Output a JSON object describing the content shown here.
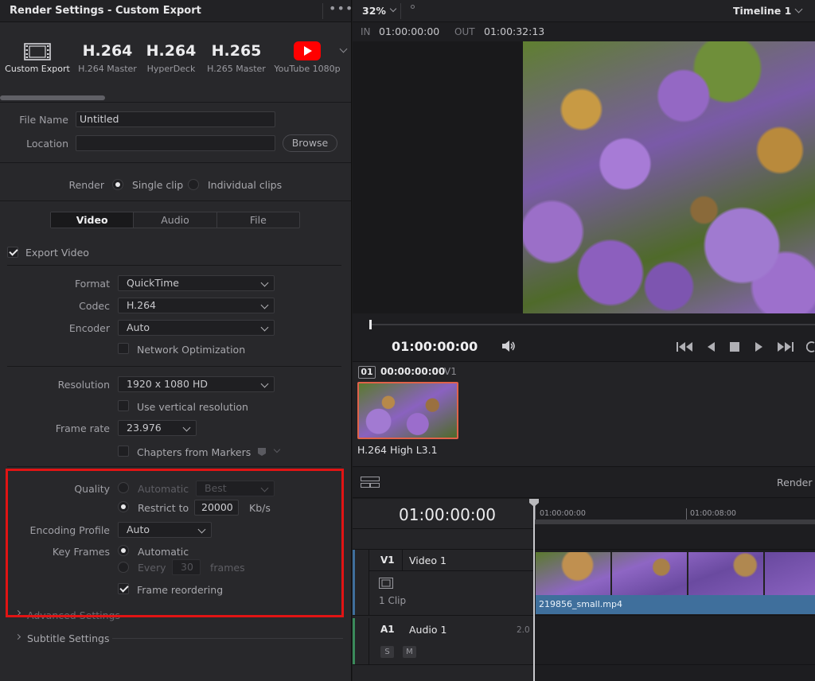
{
  "left_panel": {
    "title": "Render Settings - Custom Export",
    "menu": "•••",
    "presets": [
      {
        "title": "",
        "label": "Custom Export",
        "icon": "film-strip-icon"
      },
      {
        "title": "H.264",
        "label": "H.264 Master"
      },
      {
        "title": "H.264",
        "label": "HyperDeck"
      },
      {
        "title": "H.265",
        "label": "H.265 Master"
      },
      {
        "title": "",
        "label": "YouTube 1080p",
        "icon": "youtube-icon"
      }
    ],
    "file_name_label": "File Name",
    "file_name_value": "Untitled",
    "location_label": "Location",
    "location_value": "",
    "browse_label": "Browse",
    "render_label": "Render",
    "render_single": "Single clip",
    "render_individual": "Individual clips",
    "tabs": [
      "Video",
      "Audio",
      "File"
    ],
    "export_video_label": "Export Video",
    "format_label": "Format",
    "format_value": "QuickTime",
    "codec_label": "Codec",
    "codec_value": "H.264",
    "encoder_label": "Encoder",
    "encoder_value": "Auto",
    "network_opt_label": "Network Optimization",
    "resolution_label": "Resolution",
    "resolution_value": "1920 x 1080 HD",
    "vertical_res_label": "Use vertical resolution",
    "frame_rate_label": "Frame rate",
    "frame_rate_value": "23.976",
    "chapters_label": "Chapters from Markers",
    "quality_label": "Quality",
    "quality_auto": "Automatic",
    "quality_auto_value": "Best",
    "quality_restrict": "Restrict to",
    "quality_restrict_value": "20000",
    "quality_unit": "Kb/s",
    "encoding_profile_label": "Encoding Profile",
    "encoding_profile_value": "Auto",
    "key_frames_label": "Key Frames",
    "key_frames_auto": "Automatic",
    "key_frames_every": "Every",
    "key_frames_every_value": "30",
    "key_frames_unit": "frames",
    "frame_reordering_label": "Frame reordering",
    "advanced_settings": "Advanced Settings",
    "subtitle_settings": "Subtitle Settings"
  },
  "viewer": {
    "zoom": "32%",
    "timeline_name": "Timeline 1",
    "in_label": "IN",
    "in_value": "01:00:00:00",
    "out_label": "OUT",
    "out_value": "01:00:32:13",
    "timecode": "01:00:00:00"
  },
  "media": {
    "clip_index": "01",
    "clip_timecode": "00:00:00:00",
    "clip_track": "V1",
    "clip_codec": "H.264 High L3.1"
  },
  "timeline": {
    "render_label": "Render",
    "timecode": "01:00:00:00",
    "ruler": [
      "01:00:00:00",
      "01:00:08:00"
    ],
    "video_track_id": "V1",
    "video_track_name": "Video 1",
    "video_clip_count": "1 Clip",
    "clip_filename": "219856_small.mp4",
    "audio_track_id": "A1",
    "audio_track_name": "Audio 1",
    "audio_channels": "2.0",
    "solo": "S",
    "mute": "M"
  },
  "colors": {
    "highlight_box": "#e11414",
    "clip_blue": "#3f6f9c",
    "thumb_border": "#e0624a",
    "youtube_red": "#ff0000"
  }
}
